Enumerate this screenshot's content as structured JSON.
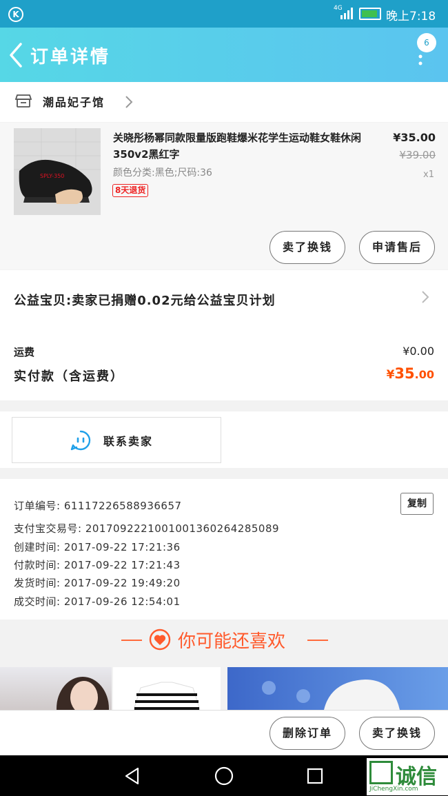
{
  "status_bar": {
    "network": "4G",
    "time": "晚上7:18",
    "badge_icon": "k-app-icon"
  },
  "header": {
    "title": "订单详情",
    "badge_count": "6"
  },
  "shop": {
    "name": "潮品妃子馆"
  },
  "product": {
    "name": "关晓彤杨幂同款限量版跑鞋爆米花学生运动鞋女鞋休闲350v2黑红字",
    "spec": "颜色分类:黑色;尺码:36",
    "tag": "8天退货",
    "price": "¥35.00",
    "original_price": "¥39.00",
    "quantity": "x1",
    "buttons": {
      "exchange": "卖了换钱",
      "after_sale": "申请售后"
    }
  },
  "charity": {
    "text": "公益宝贝:卖家已捐赠0.02元给公益宝贝计划"
  },
  "payment": {
    "freight_label": "运费",
    "freight_value": "¥0.00",
    "paid_label": "实付款（含运费）",
    "paid_currency": "¥",
    "paid_int": "35",
    "paid_dec": ".00"
  },
  "contact": {
    "label": "联系卖家"
  },
  "order_info": {
    "order_no": "订单编号: 61117226588936657",
    "alipay_no": "支付宝交易号: 2017092221001001360264285089",
    "created": "创建时间: 2017-09-22 17:21:36",
    "paid": "付款时间: 2017-09-22 17:21:43",
    "shipped": "发货时间: 2017-09-22 19:49:20",
    "completed": "成交时间: 2017-09-26 12:54:01",
    "copy_label": "复制"
  },
  "guess": {
    "title": "你可能还喜欢"
  },
  "bottom_bar": {
    "delete": "删除订单",
    "exchange": "卖了换钱"
  },
  "watermark": {
    "text": "诚信",
    "sub": "JiChengXin.com"
  },
  "colors": {
    "accent": "#1fa0c9",
    "price_orange": "#ff5000",
    "tag_red": "#e22222"
  }
}
